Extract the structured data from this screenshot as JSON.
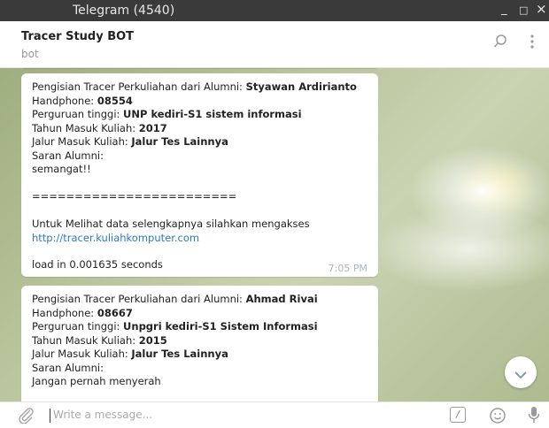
{
  "window": {
    "title": "Telegram (4540)",
    "minimize": "_",
    "maximize": "□",
    "close": "×"
  },
  "chat_header": {
    "name": "Tracer Study BOT",
    "status": "bot"
  },
  "messages": [
    {
      "intro": "Pengisian Tracer Perkuliahan dari Alumni: ",
      "alumni_name": "Styawan Ardirianto",
      "phone_label": "Handphone: ",
      "phone": "08554",
      "university_label": "Perguruan tinggi: ",
      "university": "UNP kediri-S1 sistem informasi",
      "year_label": "Tahun Masuk Kuliah: ",
      "year": "2017",
      "path_label": "Jalur Masuk Kuliah: ",
      "path": "Jalur Tes Lainnya",
      "advice_label": "Saran Alumni:",
      "advice": "semangat!!",
      "separator": "========================",
      "more_text": "Untuk Melihat data selengkapnya silahkan mengakses",
      "link": "http://tracer.kuliahkomputer.com",
      "load_time": "load in 0.001635 seconds",
      "time": "7:05 PM"
    },
    {
      "intro": "Pengisian Tracer Perkuliahan dari Alumni: ",
      "alumni_name": "Ahmad Rivai",
      "phone_label": "Handphone: ",
      "phone": "08667",
      "university_label": "Perguruan tinggi: ",
      "university": "Unpgri kediri-S1 Sistem Informasi",
      "year_label": "Tahun Masuk Kuliah: ",
      "year": "2015",
      "path_label": "Jalur Masuk Kuliah: ",
      "path": "Jalur Tes Lainnya",
      "advice_label": "Saran Alumni:",
      "advice": "Jangan pernah menyerah"
    }
  ],
  "composer": {
    "placeholder": "Write a message...",
    "command_label": "/"
  },
  "colors": {
    "titlebar": "#3a3a3a",
    "link": "#2a7cc3",
    "time": "#a9b7c4"
  },
  "icons": [
    "search-icon",
    "more-vert-icon",
    "attach-icon",
    "command-icon",
    "emoji-icon",
    "mic-icon",
    "scroll-down-icon"
  ]
}
